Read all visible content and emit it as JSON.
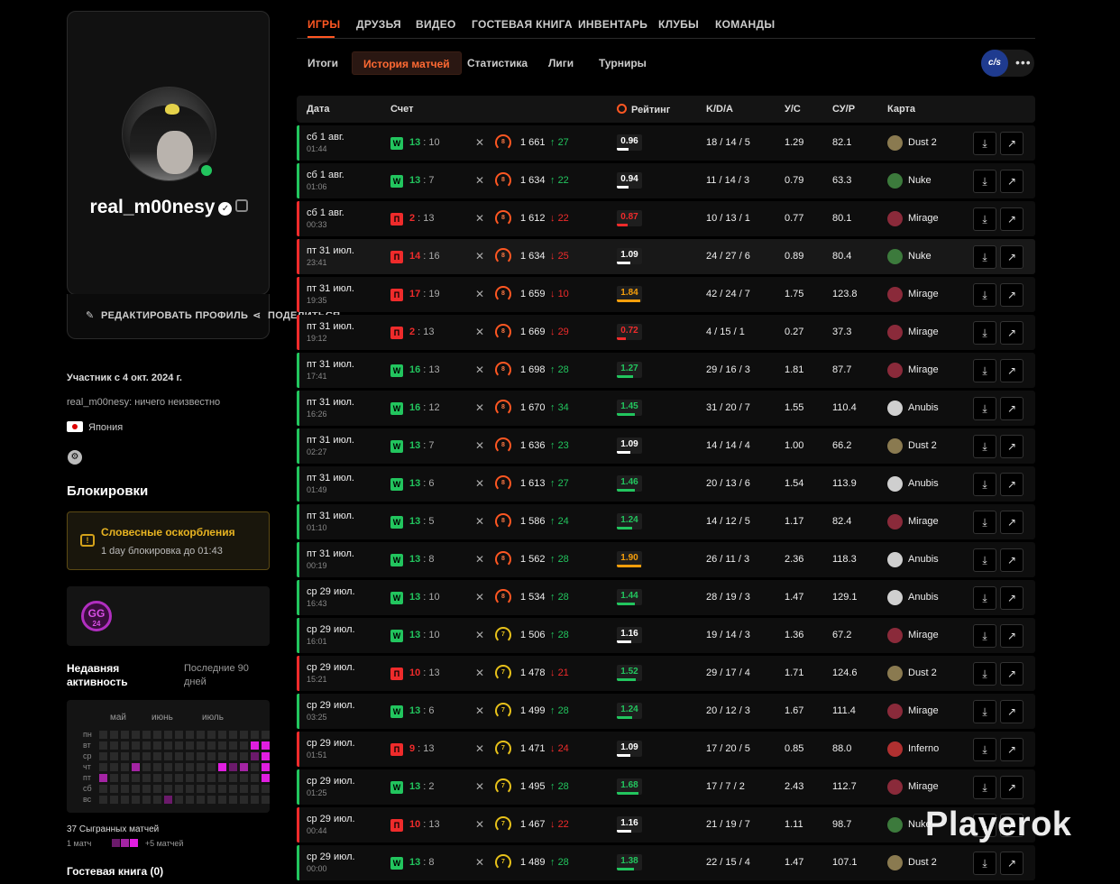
{
  "profile": {
    "username": "real_m00nesy",
    "verified_icon": "verified-badge-icon",
    "chip_icon": "chip-icon",
    "edit_label": "РЕДАКТИРОВАТЬ ПРОФИЛЬ",
    "share_label": "ПОДЕЛИТЬСЯ",
    "member_since": "Участник с 4 окт. 2024 г.",
    "bio": "real_m00nesy: ничего неизвестно",
    "country": "Япония"
  },
  "bans": {
    "title": "Блокировки",
    "ban_title": "Словесные оскорбления",
    "ban_sub": "1 day блокировка до 01:43"
  },
  "badge": {
    "line1": "GG",
    "line2": "24"
  },
  "activity": {
    "title": "Недавняя активность",
    "period": "Последние 90 дней",
    "months": [
      "май",
      "июнь",
      "июль"
    ],
    "days": [
      "пн",
      "вт",
      "ср",
      "чт",
      "пт",
      "сб",
      "вс"
    ],
    "matches_played": "37 Сыгранных матчей",
    "legend_left": "1 матч",
    "legend_right": "+5 матчей",
    "colors": {
      "empty": "#2a2a2a",
      "low": "#6b1a6b",
      "mid": "#a324a3",
      "high": "#e01ee0"
    }
  },
  "guestbook": "Гостевая книга (0)",
  "topnav": {
    "tabs": [
      "ИГРЫ",
      "ДРУЗЬЯ",
      "ВИДЕО",
      "ГОСТЕВАЯ КНИГА",
      "ИНВЕНТАРЬ",
      "КЛУБЫ",
      "КОМАНДЫ"
    ],
    "active": 0
  },
  "subnav": {
    "tabs": [
      "Итоги",
      "История матчей",
      "Статистика",
      "Лиги",
      "Турниры"
    ],
    "active": 1,
    "game_label": "c/s",
    "more": "•••"
  },
  "table": {
    "headers": {
      "date": "Дата",
      "score": "Счет",
      "rating": "Рейтинг",
      "kda": "K/D/A",
      "ks": "У/С",
      "adr": "СУ/Р",
      "map": "Карта"
    },
    "rows": [
      {
        "date": "сб 1 авг.",
        "time": "01:44",
        "result": "W",
        "own": "13",
        "opp": "10",
        "lvl": "8",
        "elo": "1 661",
        "delta": "27",
        "up": true,
        "rating": "0.96",
        "kda": "18 / 14 / 5",
        "ks": "1.29",
        "adr": "82.1",
        "map": "Dust 2"
      },
      {
        "date": "сб 1 авг.",
        "time": "01:06",
        "result": "W",
        "own": "13",
        "opp": "7",
        "lvl": "8",
        "elo": "1 634",
        "delta": "22",
        "up": true,
        "rating": "0.94",
        "kda": "11 / 14 / 3",
        "ks": "0.79",
        "adr": "63.3",
        "map": "Nuke"
      },
      {
        "date": "сб 1 авг.",
        "time": "00:33",
        "result": "П",
        "own": "2",
        "opp": "13",
        "lvl": "8",
        "elo": "1 612",
        "delta": "22",
        "up": false,
        "rating": "0.87",
        "kda": "10 / 13 / 1",
        "ks": "0.77",
        "adr": "80.1",
        "map": "Mirage"
      },
      {
        "date": "пт 31 июл.",
        "time": "23:41",
        "result": "П",
        "own": "14",
        "opp": "16",
        "lvl": "8",
        "elo": "1 634",
        "delta": "25",
        "up": false,
        "rating": "1.09",
        "kda": "24 / 27 / 6",
        "ks": "0.89",
        "adr": "80.4",
        "map": "Nuke"
      },
      {
        "date": "пт 31 июл.",
        "time": "19:35",
        "result": "П",
        "own": "17",
        "opp": "19",
        "lvl": "8",
        "elo": "1 659",
        "delta": "10",
        "up": false,
        "rating": "1.84",
        "kda": "42 / 24 / 7",
        "ks": "1.75",
        "adr": "123.8",
        "map": "Mirage"
      },
      {
        "date": "пт 31 июл.",
        "time": "19:12",
        "result": "П",
        "own": "2",
        "opp": "13",
        "lvl": "8",
        "elo": "1 669",
        "delta": "29",
        "up": false,
        "rating": "0.72",
        "kda": "4 / 15 / 1",
        "ks": "0.27",
        "adr": "37.3",
        "map": "Mirage"
      },
      {
        "date": "пт 31 июл.",
        "time": "17:41",
        "result": "W",
        "own": "16",
        "opp": "13",
        "lvl": "8",
        "elo": "1 698",
        "delta": "28",
        "up": true,
        "rating": "1.27",
        "kda": "29 / 16 / 3",
        "ks": "1.81",
        "adr": "87.7",
        "map": "Mirage"
      },
      {
        "date": "пт 31 июл.",
        "time": "16:26",
        "result": "W",
        "own": "16",
        "opp": "12",
        "lvl": "8",
        "elo": "1 670",
        "delta": "34",
        "up": true,
        "rating": "1.45",
        "kda": "31 / 20 / 7",
        "ks": "1.55",
        "adr": "110.4",
        "map": "Anubis"
      },
      {
        "date": "пт 31 июл.",
        "time": "02:27",
        "result": "W",
        "own": "13",
        "opp": "7",
        "lvl": "8",
        "elo": "1 636",
        "delta": "23",
        "up": true,
        "rating": "1.09",
        "kda": "14 / 14 / 4",
        "ks": "1.00",
        "adr": "66.2",
        "map": "Dust 2"
      },
      {
        "date": "пт 31 июл.",
        "time": "01:49",
        "result": "W",
        "own": "13",
        "opp": "6",
        "lvl": "8",
        "elo": "1 613",
        "delta": "27",
        "up": true,
        "rating": "1.46",
        "kda": "20 / 13 / 6",
        "ks": "1.54",
        "adr": "113.9",
        "map": "Anubis"
      },
      {
        "date": "пт 31 июл.",
        "time": "01:10",
        "result": "W",
        "own": "13",
        "opp": "5",
        "lvl": "8",
        "elo": "1 586",
        "delta": "24",
        "up": true,
        "rating": "1.24",
        "kda": "14 / 12 / 5",
        "ks": "1.17",
        "adr": "82.4",
        "map": "Mirage"
      },
      {
        "date": "пт 31 июл.",
        "time": "00:19",
        "result": "W",
        "own": "13",
        "opp": "8",
        "lvl": "8",
        "elo": "1 562",
        "delta": "28",
        "up": true,
        "rating": "1.90",
        "kda": "26 / 11 / 3",
        "ks": "2.36",
        "adr": "118.3",
        "map": "Anubis"
      },
      {
        "date": "ср 29 июл.",
        "time": "16:43",
        "result": "W",
        "own": "13",
        "opp": "10",
        "lvl": "8",
        "elo": "1 534",
        "delta": "28",
        "up": true,
        "rating": "1.44",
        "kda": "28 / 19 / 3",
        "ks": "1.47",
        "adr": "129.1",
        "map": "Anubis"
      },
      {
        "date": "ср 29 июл.",
        "time": "16:01",
        "result": "W",
        "own": "13",
        "opp": "10",
        "lvl": "7",
        "elo": "1 506",
        "delta": "28",
        "up": true,
        "rating": "1.16",
        "kda": "19 / 14 / 3",
        "ks": "1.36",
        "adr": "67.2",
        "map": "Mirage"
      },
      {
        "date": "ср 29 июл.",
        "time": "15:21",
        "result": "П",
        "own": "10",
        "opp": "13",
        "lvl": "7",
        "elo": "1 478",
        "delta": "21",
        "up": false,
        "rating": "1.52",
        "kda": "29 / 17 / 4",
        "ks": "1.71",
        "adr": "124.6",
        "map": "Dust 2"
      },
      {
        "date": "ср 29 июл.",
        "time": "03:25",
        "result": "W",
        "own": "13",
        "opp": "6",
        "lvl": "7",
        "elo": "1 499",
        "delta": "28",
        "up": true,
        "rating": "1.24",
        "kda": "20 / 12 / 3",
        "ks": "1.67",
        "adr": "111.4",
        "map": "Mirage"
      },
      {
        "date": "ср 29 июл.",
        "time": "01:51",
        "result": "П",
        "own": "9",
        "opp": "13",
        "lvl": "7",
        "elo": "1 471",
        "delta": "24",
        "up": false,
        "rating": "1.09",
        "kda": "17 / 20 / 5",
        "ks": "0.85",
        "adr": "88.0",
        "map": "Inferno"
      },
      {
        "date": "ср 29 июл.",
        "time": "01:25",
        "result": "W",
        "own": "13",
        "opp": "2",
        "lvl": "7",
        "elo": "1 495",
        "delta": "28",
        "up": true,
        "rating": "1.68",
        "kda": "17 / 7 / 2",
        "ks": "2.43",
        "adr": "112.7",
        "map": "Mirage"
      },
      {
        "date": "ср 29 июл.",
        "time": "00:44",
        "result": "П",
        "own": "10",
        "opp": "13",
        "lvl": "7",
        "elo": "1 467",
        "delta": "22",
        "up": false,
        "rating": "1.16",
        "kda": "21 / 19 / 7",
        "ks": "1.11",
        "adr": "98.7",
        "map": "Nuke"
      },
      {
        "date": "ср 29 июл.",
        "time": "00:00",
        "result": "W",
        "own": "13",
        "opp": "8",
        "lvl": "7",
        "elo": "1 489",
        "delta": "28",
        "up": true,
        "rating": "1.38",
        "kda": "22 / 15 / 4",
        "ks": "1.47",
        "adr": "107.1",
        "map": "Dust 2"
      }
    ]
  },
  "colors": {
    "win": "#22c55e",
    "loss": "#ef2b2b",
    "accent": "#ff5722"
  },
  "watermark": "Playerok"
}
